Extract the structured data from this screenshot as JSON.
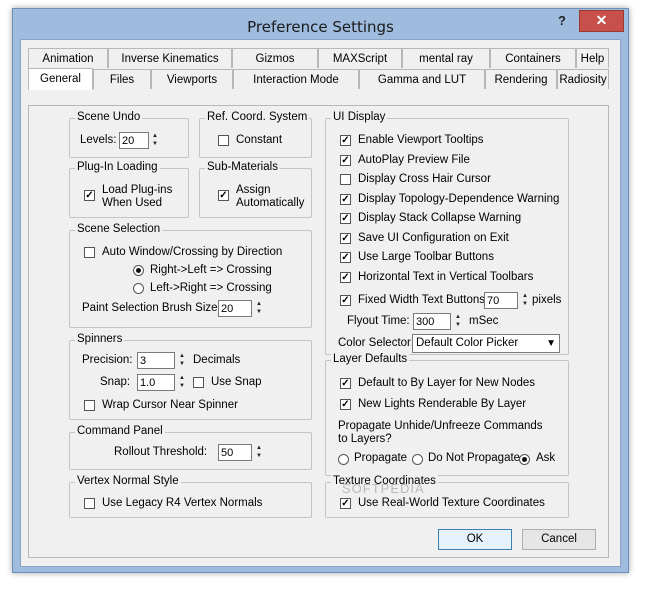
{
  "window": {
    "title": "Preference Settings",
    "help_glyph": "?",
    "close_glyph": "✕"
  },
  "tabs_row1": [
    "Animation",
    "Inverse Kinematics",
    "Gizmos",
    "MAXScript",
    "mental ray",
    "Containers",
    "Help"
  ],
  "tabs_row2": [
    "General",
    "Files",
    "Viewports",
    "Interaction Mode",
    "Gamma and LUT",
    "Rendering",
    "Radiosity"
  ],
  "active_tab": "General",
  "scene_undo": {
    "label": "Scene Undo",
    "levels_label": "Levels:",
    "levels_value": "20"
  },
  "ref_coord": {
    "label": "Ref. Coord. System",
    "constant_label": "Constant",
    "constant_checked": false
  },
  "plugin_loading": {
    "label": "Plug-In Loading",
    "load_label_1": "Load Plug-ins",
    "load_label_2": "When Used",
    "checked": true
  },
  "sub_materials": {
    "label": "Sub-Materials",
    "assign_label_1": "Assign",
    "assign_label_2": "Automatically",
    "checked": true
  },
  "scene_selection": {
    "label": "Scene Selection",
    "auto_window_label": "Auto Window/Crossing by Direction",
    "auto_window_checked": false,
    "right_left_label": "Right->Left => Crossing",
    "left_right_label": "Left->Right => Crossing",
    "selected": "right_left",
    "brush_size_label": "Paint Selection Brush Size",
    "brush_size_value": "20"
  },
  "spinners": {
    "label": "Spinners",
    "precision_label": "Precision:",
    "precision_value": "3",
    "decimals_label": "Decimals",
    "snap_label": "Snap:",
    "snap_value": "1.0",
    "use_snap_label": "Use Snap",
    "use_snap_checked": false,
    "wrap_label": "Wrap Cursor Near Spinner",
    "wrap_checked": false
  },
  "command_panel": {
    "label": "Command Panel",
    "rollout_label": "Rollout Threshold:",
    "rollout_value": "50"
  },
  "vertex_normal": {
    "label": "Vertex Normal Style",
    "legacy_label": "Use Legacy R4 Vertex Normals",
    "legacy_checked": false
  },
  "ui_display": {
    "label": "UI Display",
    "items": [
      {
        "label": "Enable Viewport Tooltips",
        "checked": true
      },
      {
        "label": "AutoPlay Preview File",
        "checked": true
      },
      {
        "label": "Display Cross Hair Cursor",
        "checked": false
      },
      {
        "label": "Display Topology-Dependence Warning",
        "checked": true
      },
      {
        "label": "Display Stack Collapse Warning",
        "checked": true
      },
      {
        "label": "Save UI Configuration on Exit",
        "checked": true
      },
      {
        "label": "Use Large Toolbar Buttons",
        "checked": true
      },
      {
        "label": "Horizontal Text in Vertical Toolbars",
        "checked": true
      }
    ],
    "fixed_width_label": "Fixed Width Text Buttons:",
    "fixed_width_checked": true,
    "fixed_width_value": "70",
    "pixels_label": "pixels",
    "flyout_label": "Flyout Time:",
    "flyout_value": "300",
    "msec_label": "mSec",
    "color_selector_label": "Color Selector:",
    "color_selector_value": "Default Color Picker"
  },
  "layer_defaults": {
    "label": "Layer Defaults",
    "default_by_layer_label": "Default to By Layer for New Nodes",
    "default_by_layer_checked": true,
    "new_lights_label": "New Lights Renderable By Layer",
    "new_lights_checked": true,
    "propagate_q1": "Propagate Unhide/Unfreeze Commands",
    "propagate_q2": "to Layers?",
    "propagate_label": "Propagate",
    "do_not_propagate_label": "Do Not Propagate",
    "ask_label": "Ask",
    "selected": "ask"
  },
  "texture_coords": {
    "label": "Texture Coordinates",
    "real_world_label": "Use Real-World Texture Coordinates",
    "checked": true
  },
  "buttons": {
    "ok": "OK",
    "cancel": "Cancel"
  },
  "watermark": "SOFTPEDIA",
  "colors": {
    "titlebar": "#9fbcdf",
    "close": "#c7504a",
    "dialog": "#f0f0f0"
  }
}
